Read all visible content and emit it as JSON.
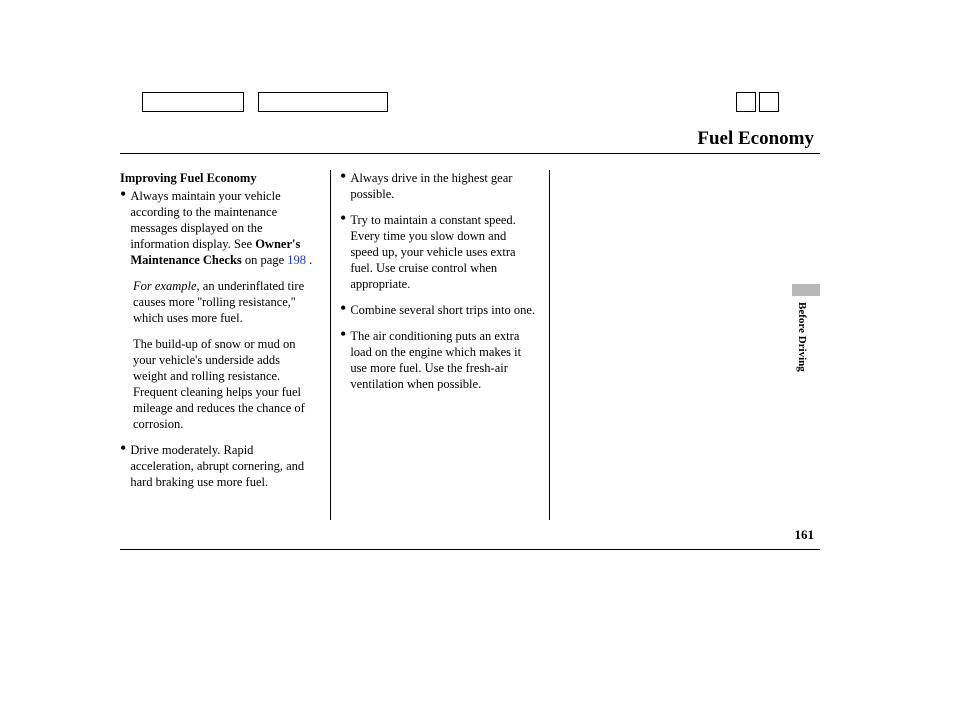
{
  "header": {
    "page_title": "Fuel Economy"
  },
  "side_tab": "Before Driving",
  "page_number": "161",
  "col1": {
    "heading": "Improving Fuel Economy",
    "b1_part1": "Always maintain your vehicle according to the maintenance messages displayed on the information display. See ",
    "b1_bold": "Owner's Maintenance Checks",
    "b1_part2": " on page ",
    "b1_link": "198",
    "b1_part3": " .",
    "p2_italic": "For example,",
    "p2_rest": " an underinflated tire causes more ''rolling resistance,'' which uses more fuel.",
    "p3": "The build-up of snow or mud on your vehicle's underside adds weight and rolling resistance. Frequent cleaning helps your fuel mileage and reduces the chance of corrosion.",
    "b2": "Drive moderately. Rapid acceleration, abrupt cornering, and hard braking use more fuel."
  },
  "col2": {
    "b1": "Always drive in the highest gear possible.",
    "b2": "Try to maintain a constant speed. Every time you slow down and speed up, your vehicle uses extra fuel. Use cruise control when appropriate.",
    "b3": "Combine several short trips into one.",
    "b4": "The air conditioning puts an extra load on the engine which makes it use more fuel. Use the fresh-air ventilation when possible."
  }
}
